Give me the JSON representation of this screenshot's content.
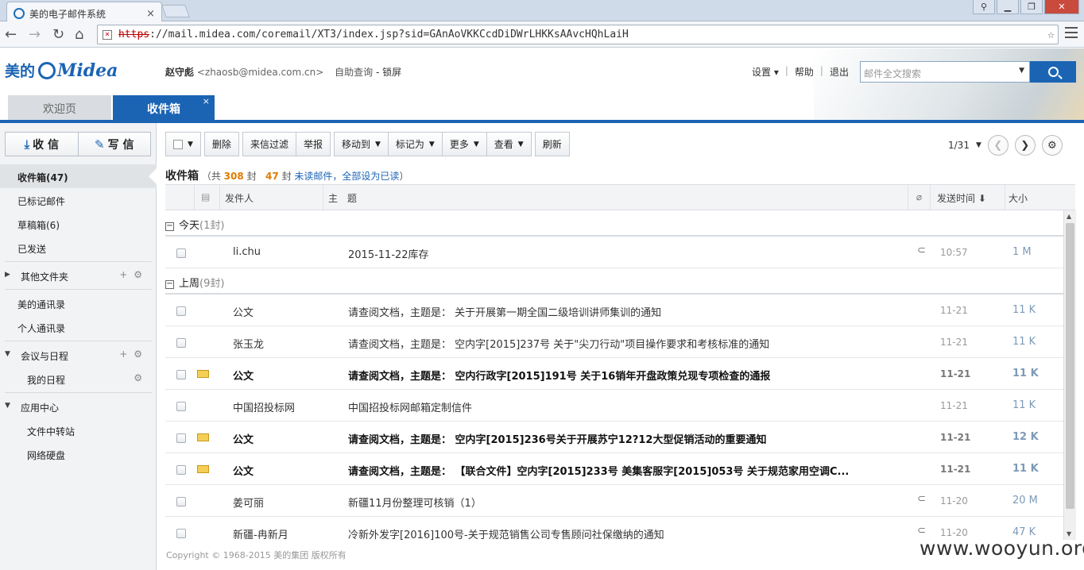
{
  "browser": {
    "tab_title": "美的电子邮件系统",
    "tab_close": "×",
    "url_scheme": "https",
    "url_rest": "://mail.midea.com/coremail/XT3/index.jsp?sid=GAnAoVKKCcdDiDWrLHKKsAAvcHQhLaiH"
  },
  "header": {
    "logo_cn": "美的",
    "logo_en": "Midea",
    "user_name": "赵守彪",
    "user_email": "<zhaosb@midea.com.cn>",
    "self_query": "自助查询",
    "dash": "-",
    "lock": "锁屏",
    "settings": "设置 ▾",
    "help": "帮助",
    "logout": "退出",
    "sep": "|",
    "search_placeholder": "邮件全文搜索"
  },
  "tabs": {
    "welcome": "欢迎页",
    "inbox": "收件箱",
    "close": "×"
  },
  "sidebar": {
    "receive": "收 信",
    "compose": "写 信",
    "items": [
      {
        "label": "收件箱(47)"
      },
      {
        "label": "已标记邮件"
      },
      {
        "label": "草稿箱(6)"
      },
      {
        "label": "已发送"
      },
      {
        "label": "其他文件夹"
      },
      {
        "label": "美的通讯录"
      },
      {
        "label": "个人通讯录"
      },
      {
        "label": "会议与日程"
      },
      {
        "label": "我的日程"
      },
      {
        "label": "应用中心"
      },
      {
        "label": "文件中转站"
      },
      {
        "label": "网络硬盘"
      }
    ]
  },
  "toolbar": {
    "delete": "删除",
    "filter": "来信过滤",
    "report": "举报",
    "move": "移动到",
    "mark": "标记为",
    "more": "更多",
    "view": "查看",
    "refresh": "刷新",
    "page": "1/31"
  },
  "folder_title": {
    "name": "收件箱",
    "total_pre": "（共",
    "total": "308",
    "total_post": "封",
    "unread": "47",
    "unread_post": "封",
    "unread_link": "未读邮件",
    "mark_all": "，全部设为已读",
    "close_paren": "）"
  },
  "columns": {
    "sender": "发件人",
    "subject": "主　题",
    "time": "发送时间 ⬇",
    "size": "大小"
  },
  "groups": [
    {
      "label": "今天",
      "count": "(1封)"
    },
    {
      "label": "上周",
      "count": "(9封)"
    }
  ],
  "emails": [
    {
      "sender": "li.chu",
      "subject": "2015-11-22库存",
      "time": "10:57",
      "size": "1 M"
    },
    {
      "sender": "公文",
      "subject": "请查阅文档，主题是： 关于开展第一期全国二级培训讲师集训的通知",
      "time": "11-21",
      "size": "11 K"
    },
    {
      "sender": "张玉龙",
      "subject": "请查阅文档，主题是： 空内字[2015]237号 关于\"尖刀行动\"项目操作要求和考核标准的通知",
      "time": "11-21",
      "size": "11 K"
    },
    {
      "sender": "公文",
      "subject": "请查阅文档，主题是： 空内行政字[2015]191号 关于16销年开盘政策兑现专项检查的通报",
      "time": "11-21",
      "size": "11 K"
    },
    {
      "sender": "中国招投标网",
      "subject": "中国招投标网邮箱定制信件",
      "time": "11-21",
      "size": "11 K"
    },
    {
      "sender": "公文",
      "subject": "请查阅文档，主题是： 空内字[2015]236号关于开展苏宁12?12大型促销活动的重要通知",
      "time": "11-21",
      "size": "12 K"
    },
    {
      "sender": "公文",
      "subject": "请查阅文档，主题是： 【联合文件】空内字[2015]233号 美集客服字[2015]053号 关于规范家用空调C...",
      "time": "11-21",
      "size": "11 K"
    },
    {
      "sender": "姜可丽",
      "subject": "新疆11月份整理可核销（1）",
      "time": "11-20",
      "size": "20 M"
    },
    {
      "sender": "新疆-冉新月",
      "subject": "冷新外发字[2016]100号-关于规范销售公司专售顾问社保缴纳的通知",
      "time": "11-20",
      "size": "47 K"
    }
  ],
  "footer": {
    "copyright": "Copyright © 1968-2015 美的集团 版权所有",
    "watermark": "www.wooyun.org"
  },
  "colors": {
    "brand": "#1b64b4",
    "count": "#e07b00"
  }
}
